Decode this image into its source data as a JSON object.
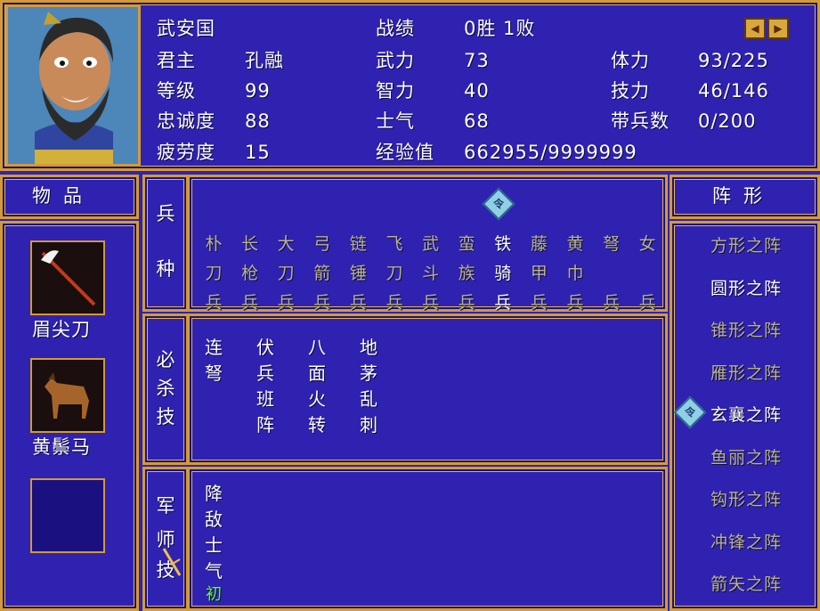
{
  "general": {
    "name": "武安国",
    "lord_label": "君主",
    "lord_value": "孔融",
    "level_label": "等级",
    "level_value": "99",
    "loyalty_label": "忠诚度",
    "loyalty_value": "88",
    "fatigue_label": "疲劳度",
    "fatigue_value": "15",
    "record_label": "战绩",
    "record_value": "0胜 1败",
    "force_label": "武力",
    "force_value": "73",
    "intel_label": "智力",
    "intel_value": "40",
    "morale_label": "士气",
    "morale_value": "68",
    "exp_label": "经验值",
    "exp_value": "662955/9999999",
    "hp_label": "体力",
    "hp_value": "93/225",
    "sp_label": "技力",
    "sp_value": "46/146",
    "troops_label": "带兵数",
    "troops_value": "0/200"
  },
  "nav": {
    "prev": "◀",
    "next": "▶"
  },
  "items_panel": {
    "title": "物品",
    "items": [
      {
        "name": "眉尖刀",
        "icon": "glaive-icon"
      },
      {
        "name": "黄鬃马",
        "icon": "horse-icon"
      },
      {
        "name": "",
        "icon": "empty-slot"
      }
    ]
  },
  "troop_types": {
    "title_1": "兵",
    "title_2": "种",
    "marker": "令",
    "columns": [
      {
        "chars": [
          "朴",
          "刀",
          "兵"
        ],
        "active": false
      },
      {
        "chars": [
          "长",
          "枪",
          "兵"
        ],
        "active": false
      },
      {
        "chars": [
          "大",
          "刀",
          "兵"
        ],
        "active": false
      },
      {
        "chars": [
          "弓",
          "箭",
          "兵"
        ],
        "active": false
      },
      {
        "chars": [
          "链",
          "锤",
          "兵"
        ],
        "active": false
      },
      {
        "chars": [
          "飞",
          "刀",
          "兵"
        ],
        "active": false
      },
      {
        "chars": [
          "武",
          "斗",
          "兵"
        ],
        "active": false
      },
      {
        "chars": [
          "蛮",
          "族",
          "兵"
        ],
        "active": false
      },
      {
        "chars": [
          "铁",
          "骑",
          "兵"
        ],
        "active": true
      },
      {
        "chars": [
          "藤",
          "甲",
          "兵"
        ],
        "active": false
      },
      {
        "chars": [
          "黄",
          "巾",
          "兵"
        ],
        "active": false
      },
      {
        "chars": [
          "弩",
          "",
          "兵"
        ],
        "active": false
      },
      {
        "chars": [
          "女",
          "",
          "兵"
        ],
        "active": false
      }
    ]
  },
  "special_skills": {
    "title": [
      "必",
      "杀",
      "技"
    ],
    "columns": [
      [
        "连",
        "弩"
      ],
      [
        "伏",
        "兵",
        "班",
        "阵"
      ],
      [
        "八",
        "面",
        "火",
        "转"
      ],
      [
        "地",
        "茅",
        "乱",
        "刺"
      ]
    ]
  },
  "strategist_skills": {
    "title": [
      "军",
      "师",
      "技"
    ],
    "column": [
      "降",
      "敌",
      "士",
      "气"
    ],
    "level": "初"
  },
  "formations": {
    "title": "阵形",
    "marker": "令",
    "items": [
      {
        "label": "方形之阵",
        "active": false
      },
      {
        "label": "圆形之阵",
        "active": true
      },
      {
        "label": "锥形之阵",
        "active": false
      },
      {
        "label": "雁形之阵",
        "active": false
      },
      {
        "label": "玄襄之阵",
        "active": true,
        "selected": true
      },
      {
        "label": "鱼丽之阵",
        "active": false
      },
      {
        "label": "钩形之阵",
        "active": false
      },
      {
        "label": "冲锋之阵",
        "active": false
      },
      {
        "label": "箭矢之阵",
        "active": false
      }
    ]
  },
  "colors": {
    "panel": "#2f22b0",
    "border": "#d49a36",
    "dim_text": "#b9b48a",
    "green": "#5cff3a"
  }
}
